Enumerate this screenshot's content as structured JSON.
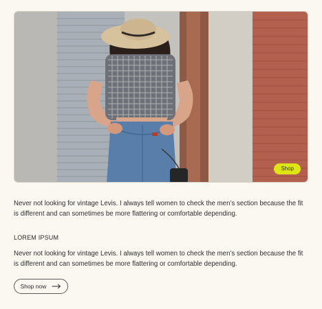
{
  "hero": {
    "shop_pill_label": "Shop"
  },
  "content": {
    "paragraph_1": "Never not looking for vintage Levis. I always tell women to check the men’s section because the fit is different and can sometimes be more flattering or comfortable depending.",
    "heading": "LOREM IPSUM",
    "paragraph_2": "Never not looking for vintage Levis. I always tell women to check the men’s section because the fit is different and can sometimes be more flattering or comfortable depending.",
    "shop_now_label": "Shop now",
    "shop_now_icon": "arrow-right-icon"
  },
  "colors": {
    "page_background": "#fbf7f1",
    "accent_pill": "#dfe514",
    "brick": "#b4604f"
  }
}
